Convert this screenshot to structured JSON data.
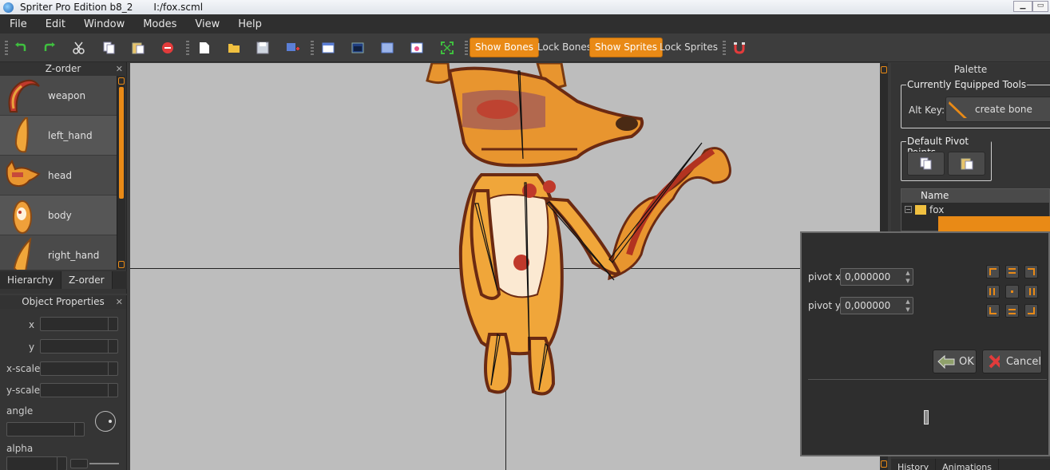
{
  "window": {
    "app_title": "Spriter Pro Edition b8_2",
    "file_path": "I:/fox.scml"
  },
  "menu": [
    "File",
    "Edit",
    "Window",
    "Modes",
    "View",
    "Help"
  ],
  "toolbar": {
    "icons": [
      "undo-icon",
      "redo-icon",
      "cut-icon",
      "copy-icon",
      "paste-icon",
      "delete-icon",
      "new-file-icon",
      "open-folder-icon",
      "save-icon",
      "add-image-icon",
      "panel-1-icon",
      "panel-2-icon",
      "panel-3-icon",
      "panel-4-icon",
      "fit-icon",
      "snap-magnet-icon"
    ],
    "show_bones": "Show Bones",
    "lock_bones": "Lock Bones",
    "show_sprites": "Show Sprites",
    "lock_sprites": "Lock Sprites",
    "show_bones_on": true,
    "show_sprites_on": true
  },
  "zorder": {
    "title": "Z-order",
    "close": "✕",
    "items": [
      {
        "label": "weapon"
      },
      {
        "label": "left_hand"
      },
      {
        "label": "head"
      },
      {
        "label": "body"
      },
      {
        "label": "right_hand"
      }
    ],
    "tabs": [
      "Hierarchy",
      "Z-order"
    ]
  },
  "object_properties": {
    "title": "Object Properties",
    "close": "✕",
    "x": "x",
    "y": "y",
    "xscale": "x-scale",
    "yscale": "y-scale",
    "angle": "angle",
    "alpha": "alpha"
  },
  "palette": {
    "title": "Palette",
    "tools_group": "Currently Equipped Tools",
    "alt_key": "Alt Key:",
    "create_bone": "create bone",
    "pivot_group": "Default Pivot Points",
    "tree_header": "Name",
    "tree_root": "fox",
    "bottom_tabs": [
      "History",
      "Animations"
    ]
  },
  "pivot_dialog": {
    "pivot_x_label": "pivot x",
    "pivot_x_value": "0,000000",
    "pivot_y_label": "pivot y",
    "pivot_y_value": "0,000000",
    "ok": "OK",
    "cancel": "Cancel"
  },
  "colors": {
    "accent": "#e98a16",
    "canvas": "#bdbdbd",
    "panel": "#353535"
  }
}
